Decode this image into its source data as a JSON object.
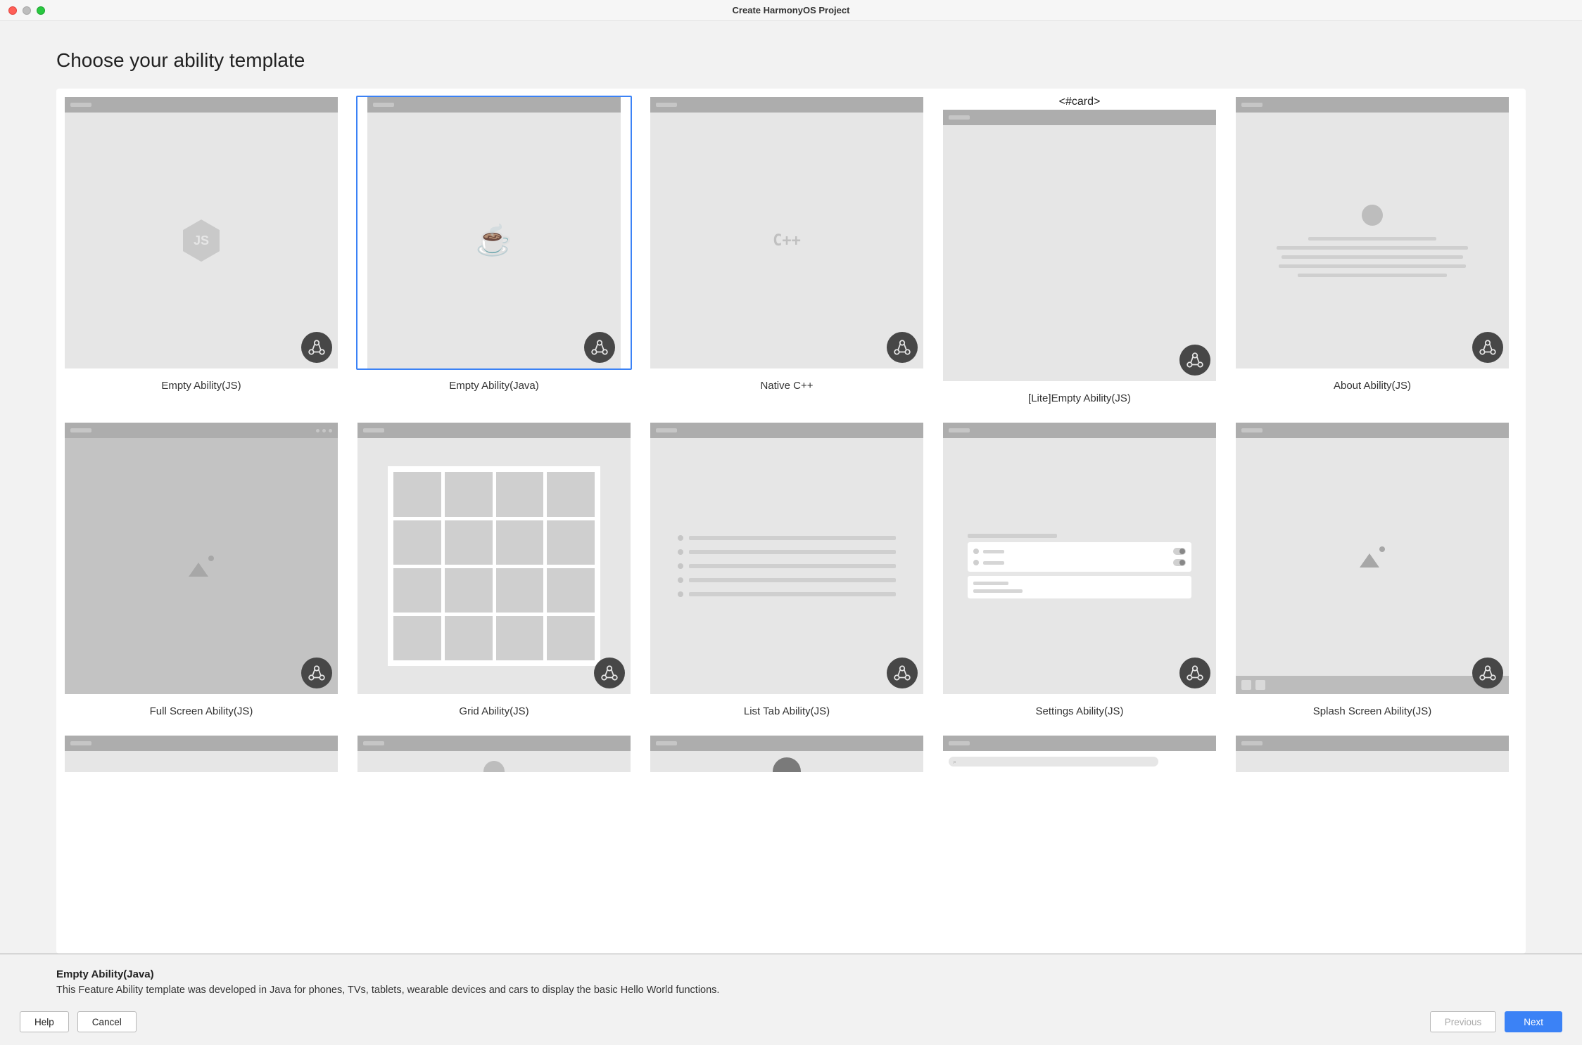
{
  "window": {
    "title": "Create HarmonyOS Project"
  },
  "page": {
    "heading": "Choose your ability template"
  },
  "templates": [
    {
      "id": "empty-js",
      "label": "Empty Ability(JS)"
    },
    {
      "id": "empty-java",
      "label": "Empty Ability(Java)",
      "selected": true
    },
    {
      "id": "native-cpp",
      "label": "Native C++"
    },
    {
      "id": "lite-empty-js",
      "label": "[Lite]Empty Ability(JS)"
    },
    {
      "id": "about-js",
      "label": "About Ability(JS)"
    },
    {
      "id": "fullscreen-js",
      "label": "Full Screen Ability(JS)"
    },
    {
      "id": "grid-js",
      "label": "Grid Ability(JS)"
    },
    {
      "id": "listtab-js",
      "label": "List Tab Ability(JS)"
    },
    {
      "id": "settings-js",
      "label": "Settings Ability(JS)"
    },
    {
      "id": "splash-js",
      "label": "Splash Screen Ability(JS)"
    }
  ],
  "description": {
    "title": "Empty Ability(Java)",
    "text": "This Feature Ability template was developed in Java for phones, TVs, tablets, wearable devices and cars to display the basic Hello World functions."
  },
  "buttons": {
    "help": "Help",
    "cancel": "Cancel",
    "previous": "Previous",
    "next": "Next"
  },
  "cpp_glyph": "C++"
}
